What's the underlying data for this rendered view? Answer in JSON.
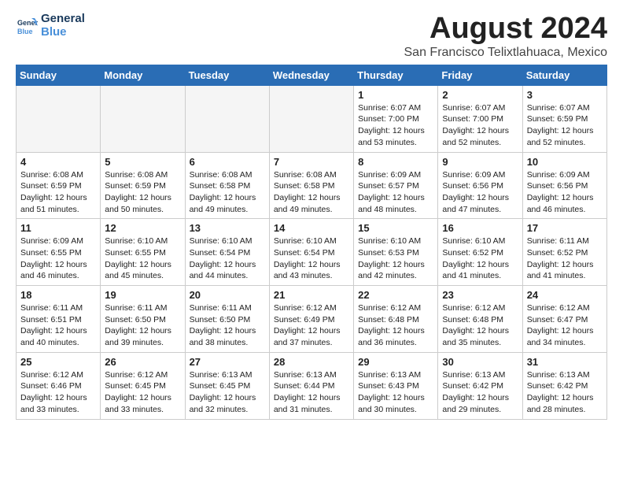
{
  "header": {
    "logo_line1": "General",
    "logo_line2": "Blue",
    "main_title": "August 2024",
    "sub_title": "San Francisco Telixtlahuaca, Mexico"
  },
  "days_of_week": [
    "Sunday",
    "Monday",
    "Tuesday",
    "Wednesday",
    "Thursday",
    "Friday",
    "Saturday"
  ],
  "weeks": [
    [
      {
        "day": "",
        "info": ""
      },
      {
        "day": "",
        "info": ""
      },
      {
        "day": "",
        "info": ""
      },
      {
        "day": "",
        "info": ""
      },
      {
        "day": "1",
        "info": "Sunrise: 6:07 AM\nSunset: 7:00 PM\nDaylight: 12 hours\nand 53 minutes."
      },
      {
        "day": "2",
        "info": "Sunrise: 6:07 AM\nSunset: 7:00 PM\nDaylight: 12 hours\nand 52 minutes."
      },
      {
        "day": "3",
        "info": "Sunrise: 6:07 AM\nSunset: 6:59 PM\nDaylight: 12 hours\nand 52 minutes."
      }
    ],
    [
      {
        "day": "4",
        "info": "Sunrise: 6:08 AM\nSunset: 6:59 PM\nDaylight: 12 hours\nand 51 minutes."
      },
      {
        "day": "5",
        "info": "Sunrise: 6:08 AM\nSunset: 6:59 PM\nDaylight: 12 hours\nand 50 minutes."
      },
      {
        "day": "6",
        "info": "Sunrise: 6:08 AM\nSunset: 6:58 PM\nDaylight: 12 hours\nand 49 minutes."
      },
      {
        "day": "7",
        "info": "Sunrise: 6:08 AM\nSunset: 6:58 PM\nDaylight: 12 hours\nand 49 minutes."
      },
      {
        "day": "8",
        "info": "Sunrise: 6:09 AM\nSunset: 6:57 PM\nDaylight: 12 hours\nand 48 minutes."
      },
      {
        "day": "9",
        "info": "Sunrise: 6:09 AM\nSunset: 6:56 PM\nDaylight: 12 hours\nand 47 minutes."
      },
      {
        "day": "10",
        "info": "Sunrise: 6:09 AM\nSunset: 6:56 PM\nDaylight: 12 hours\nand 46 minutes."
      }
    ],
    [
      {
        "day": "11",
        "info": "Sunrise: 6:09 AM\nSunset: 6:55 PM\nDaylight: 12 hours\nand 46 minutes."
      },
      {
        "day": "12",
        "info": "Sunrise: 6:10 AM\nSunset: 6:55 PM\nDaylight: 12 hours\nand 45 minutes."
      },
      {
        "day": "13",
        "info": "Sunrise: 6:10 AM\nSunset: 6:54 PM\nDaylight: 12 hours\nand 44 minutes."
      },
      {
        "day": "14",
        "info": "Sunrise: 6:10 AM\nSunset: 6:54 PM\nDaylight: 12 hours\nand 43 minutes."
      },
      {
        "day": "15",
        "info": "Sunrise: 6:10 AM\nSunset: 6:53 PM\nDaylight: 12 hours\nand 42 minutes."
      },
      {
        "day": "16",
        "info": "Sunrise: 6:10 AM\nSunset: 6:52 PM\nDaylight: 12 hours\nand 41 minutes."
      },
      {
        "day": "17",
        "info": "Sunrise: 6:11 AM\nSunset: 6:52 PM\nDaylight: 12 hours\nand 41 minutes."
      }
    ],
    [
      {
        "day": "18",
        "info": "Sunrise: 6:11 AM\nSunset: 6:51 PM\nDaylight: 12 hours\nand 40 minutes."
      },
      {
        "day": "19",
        "info": "Sunrise: 6:11 AM\nSunset: 6:50 PM\nDaylight: 12 hours\nand 39 minutes."
      },
      {
        "day": "20",
        "info": "Sunrise: 6:11 AM\nSunset: 6:50 PM\nDaylight: 12 hours\nand 38 minutes."
      },
      {
        "day": "21",
        "info": "Sunrise: 6:12 AM\nSunset: 6:49 PM\nDaylight: 12 hours\nand 37 minutes."
      },
      {
        "day": "22",
        "info": "Sunrise: 6:12 AM\nSunset: 6:48 PM\nDaylight: 12 hours\nand 36 minutes."
      },
      {
        "day": "23",
        "info": "Sunrise: 6:12 AM\nSunset: 6:48 PM\nDaylight: 12 hours\nand 35 minutes."
      },
      {
        "day": "24",
        "info": "Sunrise: 6:12 AM\nSunset: 6:47 PM\nDaylight: 12 hours\nand 34 minutes."
      }
    ],
    [
      {
        "day": "25",
        "info": "Sunrise: 6:12 AM\nSunset: 6:46 PM\nDaylight: 12 hours\nand 33 minutes."
      },
      {
        "day": "26",
        "info": "Sunrise: 6:12 AM\nSunset: 6:45 PM\nDaylight: 12 hours\nand 33 minutes."
      },
      {
        "day": "27",
        "info": "Sunrise: 6:13 AM\nSunset: 6:45 PM\nDaylight: 12 hours\nand 32 minutes."
      },
      {
        "day": "28",
        "info": "Sunrise: 6:13 AM\nSunset: 6:44 PM\nDaylight: 12 hours\nand 31 minutes."
      },
      {
        "day": "29",
        "info": "Sunrise: 6:13 AM\nSunset: 6:43 PM\nDaylight: 12 hours\nand 30 minutes."
      },
      {
        "day": "30",
        "info": "Sunrise: 6:13 AM\nSunset: 6:42 PM\nDaylight: 12 hours\nand 29 minutes."
      },
      {
        "day": "31",
        "info": "Sunrise: 6:13 AM\nSunset: 6:42 PM\nDaylight: 12 hours\nand 28 minutes."
      }
    ]
  ]
}
